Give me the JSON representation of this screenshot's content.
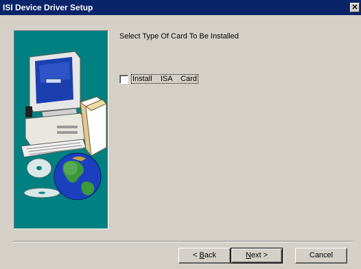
{
  "window": {
    "title": "ISI Device Driver Setup",
    "close_glyph": "✕"
  },
  "main": {
    "heading": "Select Type Of Card To Be Installed",
    "checkbox": {
      "label": "Install  ISA  Card",
      "checked": false
    }
  },
  "buttons": {
    "back": {
      "mnemonic": "B",
      "rest": "ack",
      "prefix": "< "
    },
    "next": {
      "mnemonic": "N",
      "rest": "ext",
      "suffix": " >"
    },
    "cancel": {
      "label": "Cancel"
    }
  },
  "side_panel": {
    "illustration": [
      "computer-icon",
      "cd-icon",
      "globe-icon",
      "box-icon"
    ],
    "background_color": "#008080"
  },
  "colors": {
    "titlebar": "#0a246a",
    "dialog": "#d4d0c8"
  }
}
